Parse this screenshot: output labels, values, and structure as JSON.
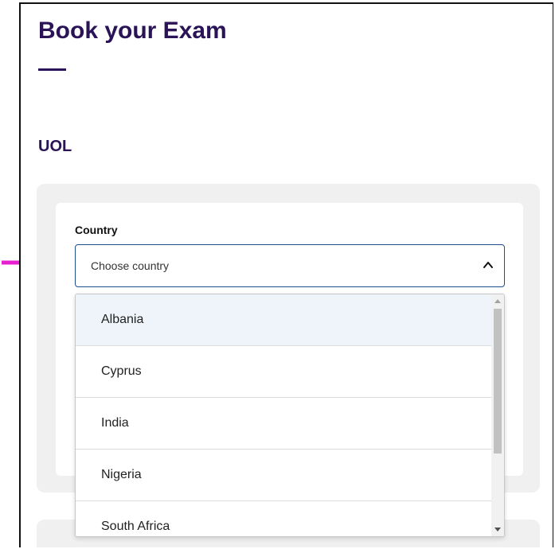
{
  "page": {
    "title": "Book your Exam",
    "section_title": "UOL"
  },
  "country_field": {
    "label": "Country",
    "placeholder": "Choose country",
    "expanded": true
  },
  "dropdown": {
    "options": [
      "Albania",
      "Cyprus",
      "India",
      "Nigeria",
      "South Africa"
    ],
    "highlighted_index": 0
  },
  "icons": {
    "select_toggle": "chevron-up-icon",
    "annotation": "arrow-right-icon"
  },
  "colors": {
    "heading": "#2a1457",
    "select_border": "#1f4f8f",
    "highlight_row": "#eef4fa",
    "panel_bg": "#f0f0f0",
    "annotation_arrow": "#e81fd0"
  }
}
